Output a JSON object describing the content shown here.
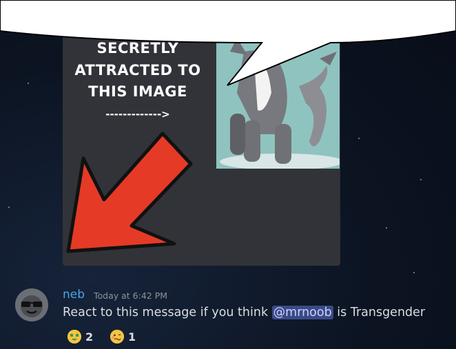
{
  "meme": {
    "line0": "SECRETLY",
    "line1": "ATTRACTED TO",
    "line2": "THIS IMAGE",
    "line3": "------------->"
  },
  "message": {
    "username": "neb",
    "timestamp": "Today at 6:42 PM",
    "text_before": "React to this message if you think ",
    "mention": "@mrnoob",
    "text_after": " is Transgender"
  },
  "reactions": [
    {
      "emoji": "money-mouth-face-icon",
      "count": "2"
    },
    {
      "emoji": "woozy-face-icon",
      "count": "1"
    }
  ],
  "colors": {
    "username": "#4aa6ea",
    "mention_bg": "#3b4a86",
    "arrow": "#e53a26",
    "embed_bg": "#313338"
  }
}
